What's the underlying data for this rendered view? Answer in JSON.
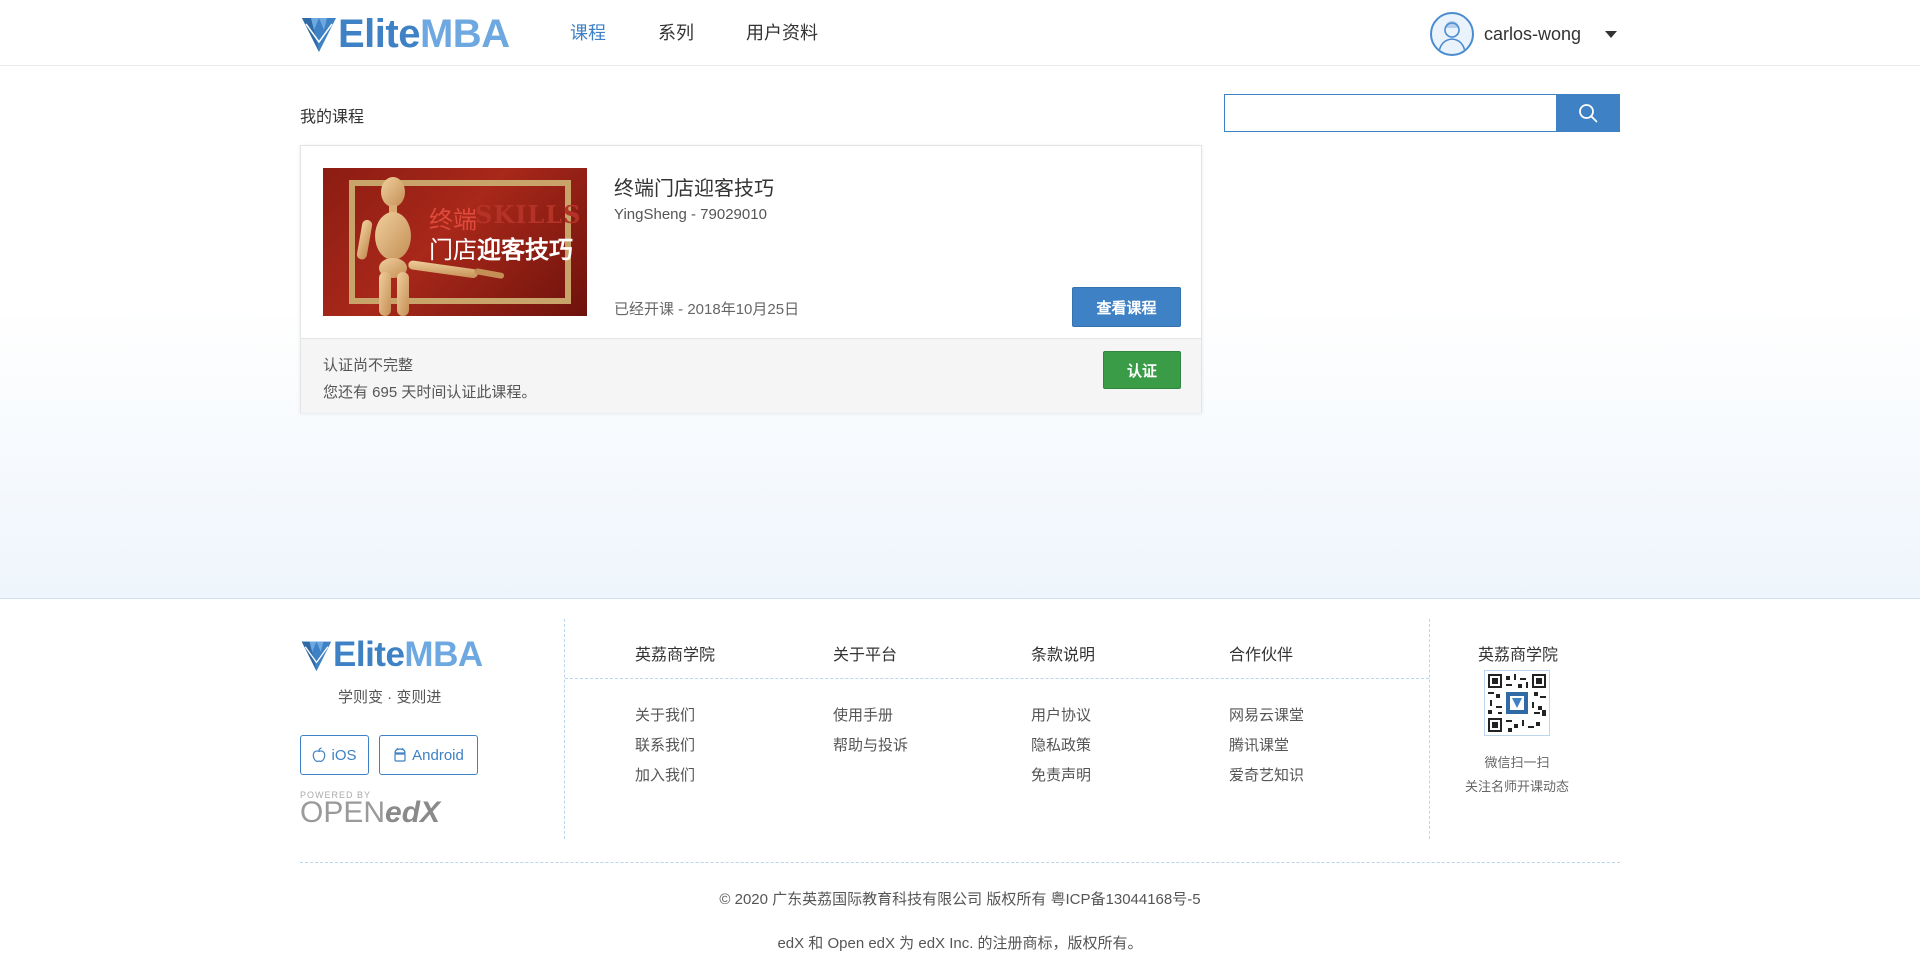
{
  "brand": {
    "part1": "Elite",
    "part2": "MBA",
    "primary_color": "#3e81c4",
    "light_color": "#6ea8e0"
  },
  "nav": {
    "items": [
      "课程",
      "系列",
      "用户资料"
    ],
    "active": "课程"
  },
  "user": {
    "name": "carlos-wong"
  },
  "main": {
    "section_title": "我的课程",
    "search": {
      "placeholder": "",
      "value": ""
    },
    "courses": [
      {
        "title": "终端门店迎客技巧",
        "org_code": "YingSheng - 79029010",
        "status": "已经开课 - 2018年10月25日",
        "view_label": "查看课程",
        "thumb": {
          "line1": "终端",
          "english": "SKILLS",
          "line2_normal": "门店",
          "line2_bold": "迎客技巧"
        },
        "verify": {
          "line1": "认证尚不完整",
          "line2": "您还有 695 天时间认证此课程。",
          "button": "认证"
        }
      }
    ]
  },
  "footer": {
    "slogan": "学则变 · 变则进",
    "apps": {
      "ios": "iOS",
      "android": "Android"
    },
    "powered_by": {
      "small": "POWERED BY",
      "open": "OPEN",
      "edx": "edX"
    },
    "columns": [
      {
        "title": "英荔商学院",
        "links": [
          "关于我们",
          "联系我们",
          "加入我们"
        ]
      },
      {
        "title": "关于平台",
        "links": [
          "使用手册",
          "帮助与投诉"
        ]
      },
      {
        "title": "条款说明",
        "links": [
          "用户协议",
          "隐私政策",
          "免责声明"
        ]
      },
      {
        "title": "合作伙伴",
        "links": [
          "网易云课堂",
          "腾讯课堂",
          "爱奇艺知识"
        ]
      }
    ],
    "qr": {
      "title": "英荔商学院",
      "line1": "微信扫一扫",
      "line2": "关注名师开课动态"
    },
    "copyright": "© 2020 广东英荔国际教育科技有限公司 版权所有 粤ICP备13044168号-5",
    "trademark": "edX 和 Open edX 为 edX Inc. 的注册商标，版权所有。"
  }
}
